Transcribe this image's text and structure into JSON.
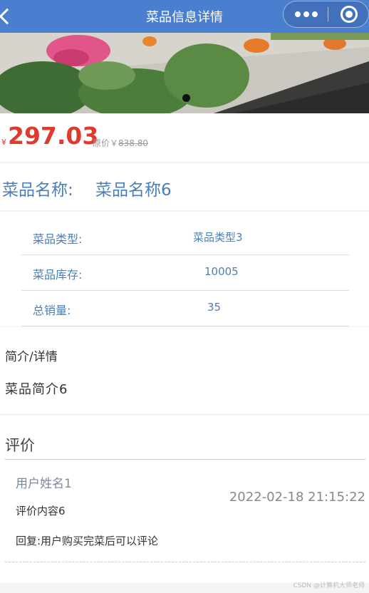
{
  "navbar": {
    "title": "菜品信息详情",
    "color": "#4a7fd0",
    "back_icon": "chevron-left-icon",
    "more_icon": "more-dots-icon",
    "close_icon": "target-circle-icon"
  },
  "banner": {
    "image": "flower-planter-photo",
    "indicator_count": 1,
    "active_index": 0
  },
  "price": {
    "currency_symbol": "¥",
    "current": "297.03",
    "original_label": "原价￥",
    "original_value": "838.80",
    "color": "#e03a2e"
  },
  "dish": {
    "name_label": "菜品名称:",
    "name_value": "菜品名称6"
  },
  "info": {
    "rows": [
      {
        "key": "菜品类型:",
        "value": "菜品类型3"
      },
      {
        "key": "菜品库存:",
        "value": "10005"
      },
      {
        "key": "总销量:",
        "value": "35"
      }
    ]
  },
  "description": {
    "title": "简介/详情",
    "text": "菜品简介6"
  },
  "reviews": {
    "title": "评价",
    "items": [
      {
        "user": "用户姓名1",
        "content": "评价内容6",
        "reply": "回复:用户购买完菜后可以评论",
        "time": "2022-02-18 21:15:22"
      }
    ]
  },
  "watermark": "CSDN @计算机大师老师"
}
